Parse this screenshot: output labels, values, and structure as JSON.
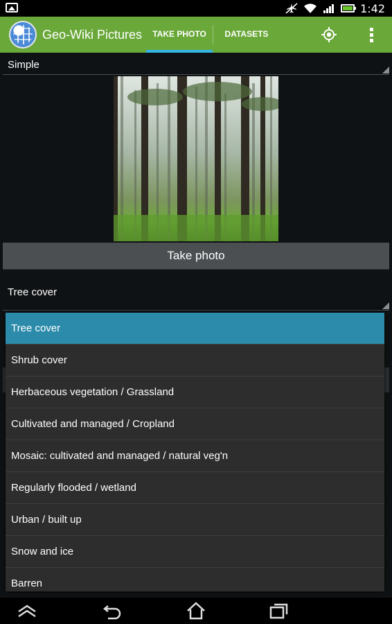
{
  "status": {
    "time": "1:42"
  },
  "appbar": {
    "title": "Geo-Wiki Pictures",
    "tabs": [
      {
        "label": "TAKE PHOTO",
        "active": true
      },
      {
        "label": "DATASETS",
        "active": false
      }
    ],
    "accent": "#6aa83a",
    "tab_indicator": "#33b5e5"
  },
  "mode_spinner": {
    "value": "Simple"
  },
  "take_photo_label": "Take photo",
  "landcover_spinner": {
    "value": "Tree cover"
  },
  "dropdown": {
    "selected": "Tree cover",
    "options": [
      "Tree cover",
      "Shrub cover",
      "Herbaceous vegetation / Grassland",
      "Cultivated and managed / Cropland",
      "Mosaic: cultivated and managed / natural veg'n",
      "Regularly flooded / wetland",
      "Urban / built up",
      "Snow and ice",
      "Barren"
    ],
    "selected_color": "#2c8bab"
  }
}
